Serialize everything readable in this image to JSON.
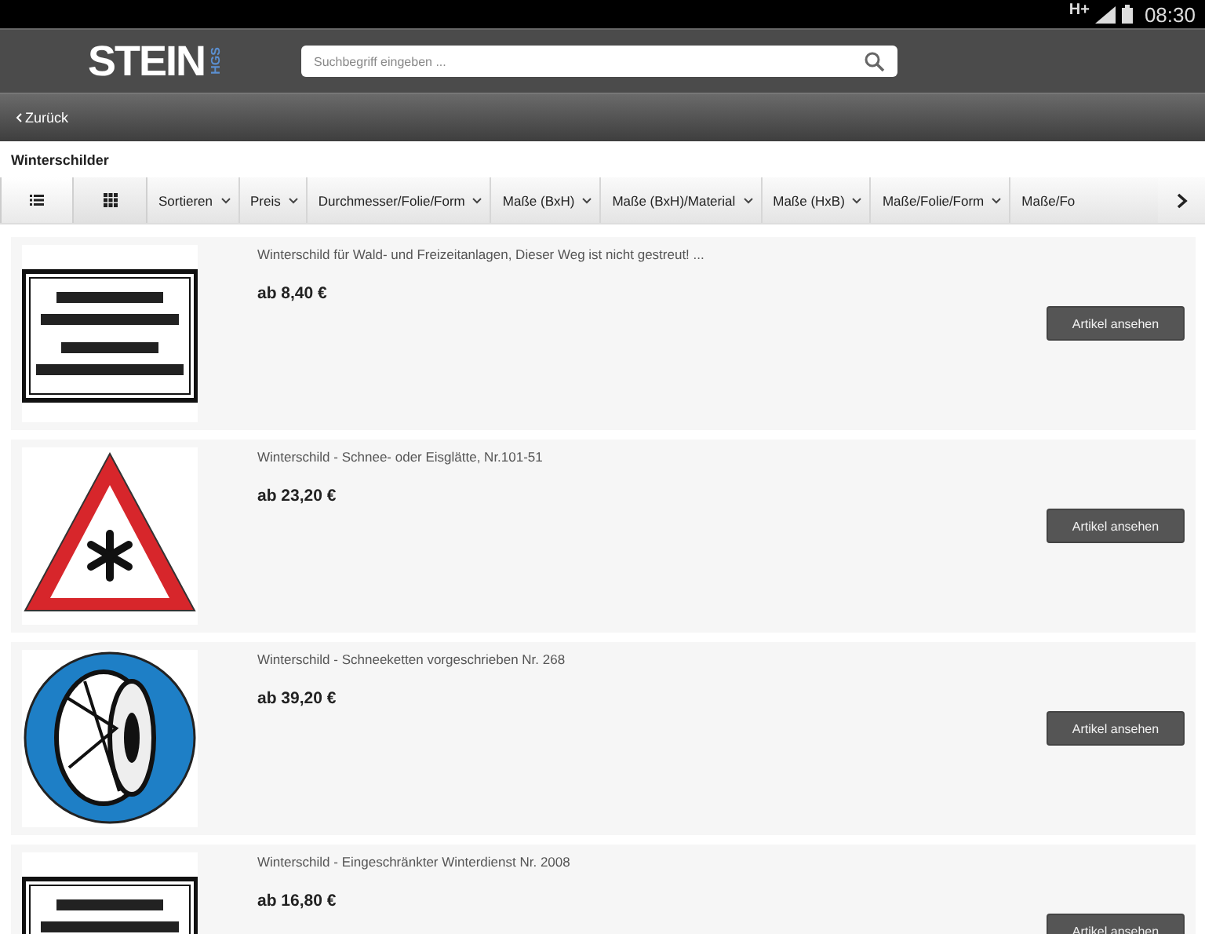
{
  "status_bar": {
    "network": "H+",
    "time": "08:30"
  },
  "header": {
    "logo": "STEIN",
    "logo_sub": "HGS",
    "search": {
      "placeholder": "Suchbegriff eingeben ..."
    }
  },
  "nav": {
    "back": "Zurück"
  },
  "page_title": "Winterschilder",
  "view_modes": [
    {
      "kind": "list",
      "selected": true
    },
    {
      "kind": "grid",
      "selected": false
    }
  ],
  "filters": [
    "Sortieren",
    "Preis",
    "Durchmesser/Folie/Form",
    "Maße (BxH)",
    "Maße (BxH)/Material",
    "Maße (HxB)",
    "Maße/Folie/Form",
    "Maße/Fo"
  ],
  "products": [
    {
      "kind": "text-sign",
      "title": "Winterschild für Wald- und Freizeitanlagen, Dieser Weg ist nicht gestreut! ...",
      "price": "ab 8,40 €",
      "button": "Artikel ansehen"
    },
    {
      "kind": "triangle-sign",
      "title": "Winterschild - Schnee- oder Eisglätte, Nr.101-51",
      "price": "ab 23,20 €",
      "button": "Artikel ansehen"
    },
    {
      "kind": "round-sign",
      "title": "Winterschild - Schneeketten vorgeschrieben Nr. 268",
      "price": "ab 39,20 €",
      "button": "Artikel ansehen"
    },
    {
      "kind": "text-sign",
      "title": "Winterschild - Eingeschränkter Winterdienst Nr. 2008",
      "price": "ab 16,80 €",
      "button": "Artikel ansehen"
    }
  ]
}
